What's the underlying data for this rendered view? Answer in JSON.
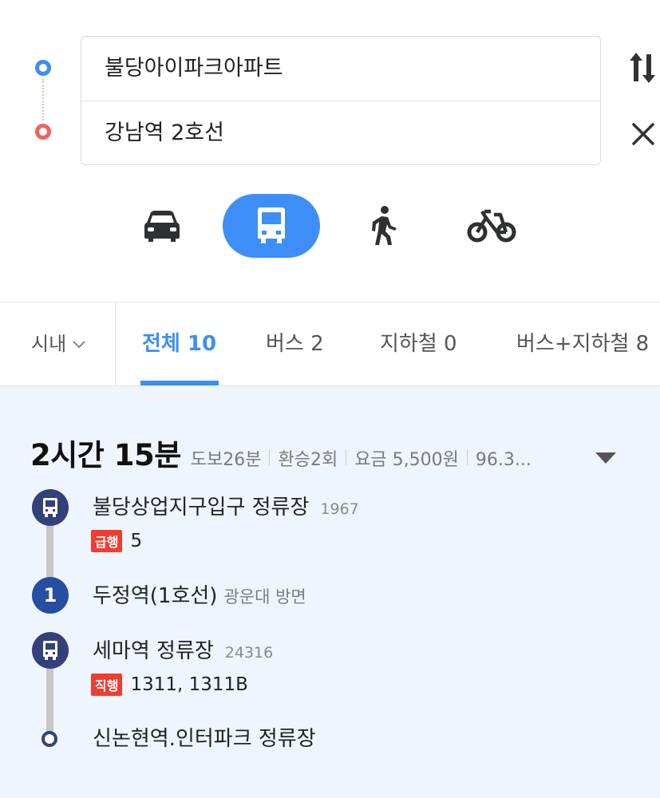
{
  "search": {
    "origin": "불당아이파크아파트",
    "destination": "강남역 2호선"
  },
  "modes": [
    {
      "icon": "car-icon",
      "active": false
    },
    {
      "icon": "bus-icon",
      "active": true
    },
    {
      "icon": "walk-icon",
      "active": false
    },
    {
      "icon": "bicycle-icon",
      "active": false
    }
  ],
  "filter": {
    "region": "시내",
    "tabs": [
      {
        "label": "전체 10",
        "active": true
      },
      {
        "label": "버스 2",
        "active": false
      },
      {
        "label": "지하철 0",
        "active": false
      },
      {
        "label": "버스+지하철 8",
        "active": false
      }
    ]
  },
  "route": {
    "total_time": "2시간 15분",
    "walk": "도보26분",
    "transfer": "환승2회",
    "fare": "요금 5,500원",
    "distance": "96.3...",
    "steps": [
      {
        "type": "bus",
        "name": "불당상업지구입구 정류장",
        "code": "1967",
        "badge": "급행",
        "routes": "5"
      },
      {
        "type": "subway",
        "line_no": "1",
        "name": "두정역(1호선)",
        "direction": "광운대 방면"
      },
      {
        "type": "bus",
        "name": "세마역 정류장",
        "code": "24316",
        "badge": "직행",
        "routes": "1311, 1311B"
      },
      {
        "type": "end",
        "name": "신논현역.인터파크 정류장"
      }
    ]
  },
  "colors": {
    "accent": "#3e8ef7",
    "origin_pin": "#3f8cf4",
    "destination_pin": "#f06260",
    "bus_node": "#34407a",
    "subway_line1": "#264ea1",
    "badge": "#ef3e30",
    "result_bg": "#eef5fd"
  }
}
